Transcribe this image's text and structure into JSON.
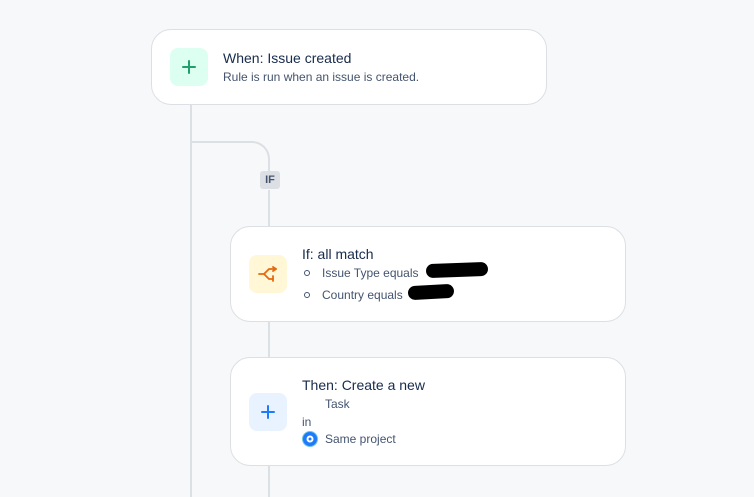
{
  "trigger": {
    "title": "When: Issue created",
    "description": "Rule is run when an issue is created.",
    "icon": "plus-icon",
    "icon_color": "#22a06b",
    "icon_bg": "#dcfff1"
  },
  "if_badge": "IF",
  "condition": {
    "title": "If: all match",
    "items": [
      "Issue Type equals",
      "Country equals"
    ],
    "icon": "branch-icon",
    "icon_color": "#e56910",
    "icon_bg": "#fff7d6"
  },
  "action": {
    "title": "Then: Create a new",
    "issue_type": "Task",
    "in_label": "in",
    "project": "Same project",
    "icon": "plus-icon",
    "icon_color": "#1d7afc",
    "icon_bg": "#e9f2ff"
  }
}
